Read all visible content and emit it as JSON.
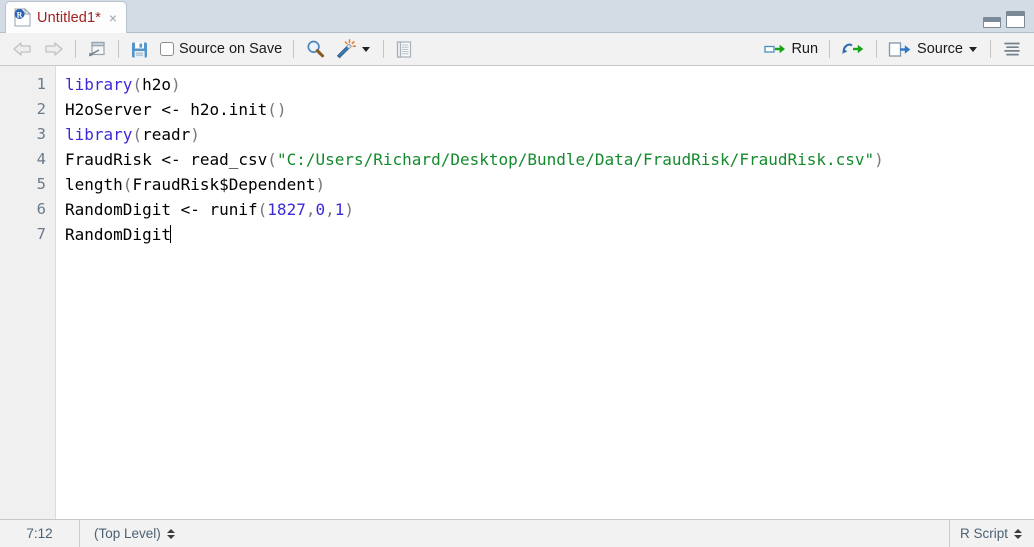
{
  "tab": {
    "label": "Untitled1*",
    "close_glyph": "×",
    "icon": "r-document-icon"
  },
  "pane_controls": {
    "minimize": "minimize-pane-icon",
    "maximize": "maximize-pane-icon"
  },
  "toolbar": {
    "back": "back-arrow-icon",
    "forward": "forward-arrow-icon",
    "popout": "show-in-new-window-icon",
    "save": "save-icon",
    "source_on_save_label": "Source on Save",
    "source_on_save_checked": false,
    "find": "search-icon",
    "magic_wand": "code-tools-icon",
    "compile_report": "compile-report-icon",
    "run_label": "Run",
    "run_icon": "run-icon",
    "rerun_icon": "re-run-icon",
    "source_label": "Source",
    "source_icon": "source-icon",
    "outline_icon": "document-outline-icon"
  },
  "editor": {
    "line_numbers": [
      "1",
      "2",
      "3",
      "4",
      "5",
      "6",
      "7"
    ],
    "lines": [
      {
        "n": 1,
        "tokens": [
          {
            "t": "library",
            "c": "fn"
          },
          {
            "t": "(",
            "c": "paren"
          },
          {
            "t": "h2o",
            "c": "plain"
          },
          {
            "t": ")",
            "c": "paren"
          }
        ]
      },
      {
        "n": 2,
        "tokens": [
          {
            "t": "H2oServer ",
            "c": "plain"
          },
          {
            "t": "<-",
            "c": "op"
          },
          {
            "t": " h2o.init",
            "c": "plain"
          },
          {
            "t": "()",
            "c": "paren"
          }
        ]
      },
      {
        "n": 3,
        "tokens": [
          {
            "t": "library",
            "c": "fn"
          },
          {
            "t": "(",
            "c": "paren"
          },
          {
            "t": "readr",
            "c": "plain"
          },
          {
            "t": ")",
            "c": "paren"
          }
        ]
      },
      {
        "n": 4,
        "tokens": [
          {
            "t": "FraudRisk ",
            "c": "plain"
          },
          {
            "t": "<-",
            "c": "op"
          },
          {
            "t": " read_csv",
            "c": "plain"
          },
          {
            "t": "(",
            "c": "paren"
          },
          {
            "t": "\"C:/Users/Richard/Desktop/Bundle/Data/FraudRisk/FraudRisk.csv\"",
            "c": "string"
          },
          {
            "t": ")",
            "c": "paren"
          }
        ]
      },
      {
        "n": 5,
        "tokens": [
          {
            "t": "length",
            "c": "plain"
          },
          {
            "t": "(",
            "c": "paren"
          },
          {
            "t": "FraudRisk",
            "c": "plain"
          },
          {
            "t": "$",
            "c": "plain"
          },
          {
            "t": "Dependent",
            "c": "plain"
          },
          {
            "t": ")",
            "c": "paren"
          }
        ]
      },
      {
        "n": 6,
        "tokens": [
          {
            "t": "RandomDigit ",
            "c": "plain"
          },
          {
            "t": "<-",
            "c": "op"
          },
          {
            "t": " runif",
            "c": "plain"
          },
          {
            "t": "(",
            "c": "paren"
          },
          {
            "t": "1827",
            "c": "num"
          },
          {
            "t": ",",
            "c": "paren"
          },
          {
            "t": "0",
            "c": "num"
          },
          {
            "t": ",",
            "c": "paren"
          },
          {
            "t": "1",
            "c": "num"
          },
          {
            "t": ")",
            "c": "paren"
          }
        ]
      },
      {
        "n": 7,
        "tokens": [
          {
            "t": "RandomDigit",
            "c": "plain"
          }
        ],
        "cursor": true
      }
    ]
  },
  "statusbar": {
    "cursor_position": "7:12",
    "scope": "(Top Level)",
    "file_type": "R Script"
  },
  "colors": {
    "tabbar_bg": "#d3dce5",
    "tab_text": "#a02222",
    "toolbar_bg": "#f2f2f2",
    "keyword": "#3b2bd6",
    "string": "#158a2e",
    "number": "#3b2bd6",
    "paren": "#787878",
    "gutter_number": "#6b7b8c",
    "status_text": "#4d6173",
    "run_arrow": "#18a317"
  }
}
